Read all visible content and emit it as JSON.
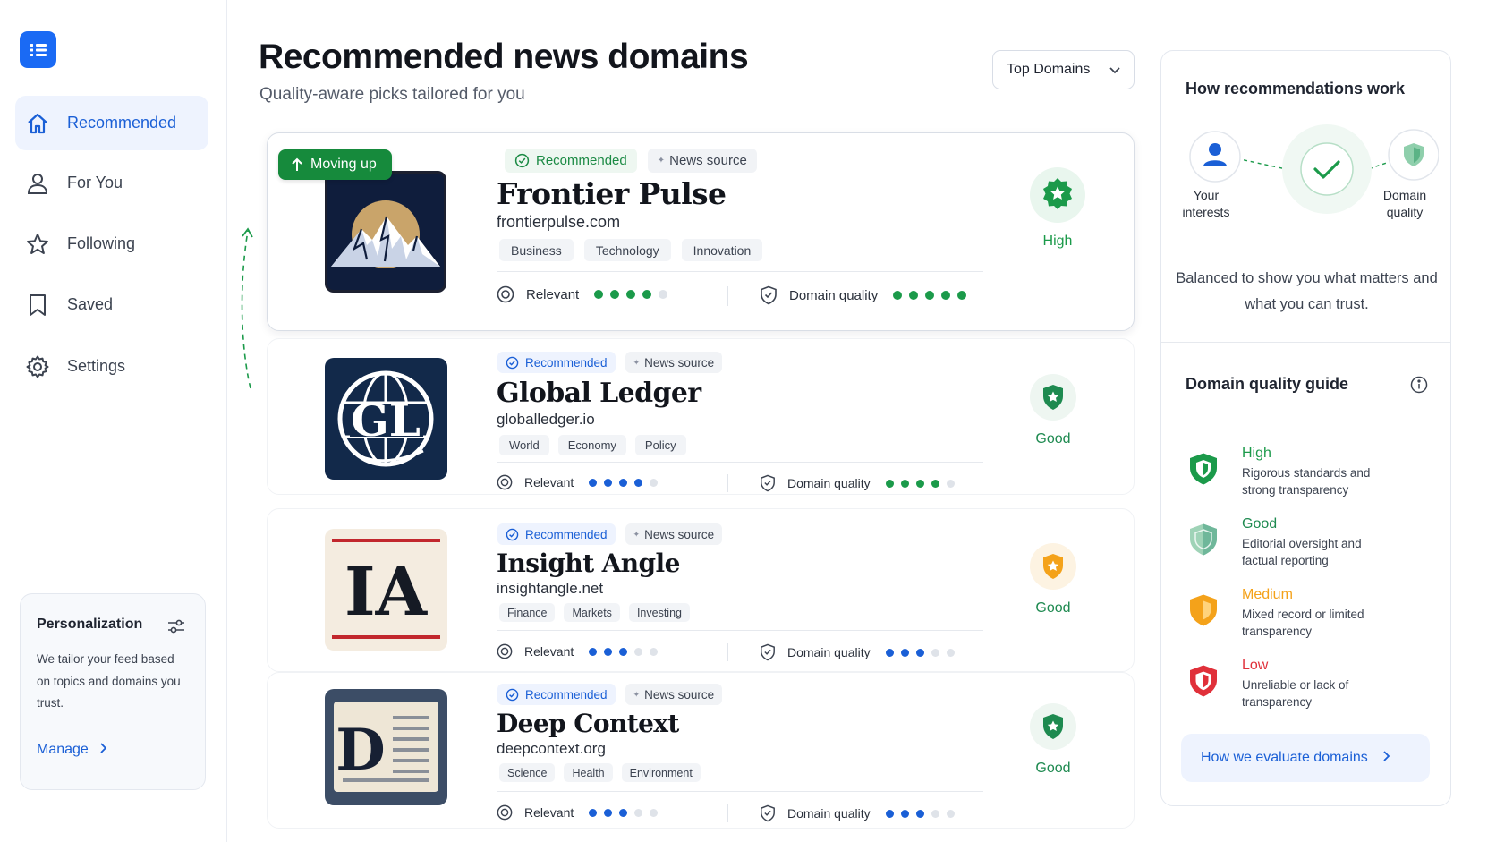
{
  "sidebar": {
    "logo_icon": "list-app-icon",
    "items": [
      {
        "label": "Recommended",
        "icon": "home-icon",
        "active": true
      },
      {
        "label": "For You",
        "icon": "user-icon",
        "active": false
      },
      {
        "label": "Following",
        "icon": "star-icon",
        "active": false
      },
      {
        "label": "Saved",
        "icon": "bookmark-icon",
        "active": false
      },
      {
        "label": "Settings",
        "icon": "gear-icon",
        "active": false
      }
    ],
    "personalization": {
      "title": "Personalization",
      "description": "We tailor your feed based on topics and domains you trust.",
      "link": "Manage"
    }
  },
  "header": {
    "title": "Recommended news domains",
    "subtitle": "Quality-aware picks tailored for you",
    "filter": "Top Domains"
  },
  "cards": [
    {
      "rank_badge": "Moving up",
      "recommended": "Recommended",
      "source_type": "News source",
      "name": "Frontier Pulse",
      "domain": "frontierpulse.com",
      "tags": [
        "Business",
        "Technology",
        "Innovation"
      ],
      "relevance_label": "Relevant",
      "relevance": 4,
      "quality_label": "Domain quality",
      "quality_level": 5,
      "rating": "High"
    },
    {
      "recommended": "Recommended",
      "source_type": "News source",
      "name": "Global Ledger",
      "domain": "globalledger.io",
      "logo_text": "GL",
      "tags": [
        "World",
        "Economy",
        "Policy"
      ],
      "relevance_label": "Relevant",
      "relevance": 4,
      "quality_label": "Domain quality",
      "quality_level": 4,
      "rating": "Good"
    },
    {
      "recommended": "Recommended",
      "source_type": "News source",
      "name": "Insight Angle",
      "domain": "insightangle.net",
      "logo_text": "IA",
      "tags": [
        "Finance",
        "Markets",
        "Investing"
      ],
      "relevance_label": "Relevant",
      "relevance": 3,
      "quality_label": "Domain quality",
      "quality_level": 3,
      "rating": "Good"
    },
    {
      "recommended": "Recommended",
      "source_type": "News source",
      "name": "Deep Context",
      "domain": "deepcontext.org",
      "logo_text": "D",
      "tags": [
        "Science",
        "Health",
        "Environment"
      ],
      "relevance_label": "Relevant",
      "relevance": 3,
      "quality_label": "Domain quality",
      "quality_level": 3,
      "rating": "Good"
    }
  ],
  "panel": {
    "title": "How recommendations work",
    "flow": {
      "left": "Your interests",
      "right": "Domain quality"
    },
    "description": "Balanced to show you what matters and what you can trust.",
    "guide_title": "Domain quality guide",
    "guide": [
      {
        "name": "High",
        "desc": "Rigorous standards and strong transparency",
        "color": "#1b9a4a"
      },
      {
        "name": "Good",
        "desc": "Editorial oversight and factual reporting",
        "color": "#6fb79a"
      },
      {
        "name": "Medium",
        "desc": "Mixed record or limited transparency",
        "color": "#f4a21a"
      },
      {
        "name": "Low",
        "desc": "Unreliable or lack of transparency",
        "color": "#e0303a"
      }
    ],
    "cta": "How we evaluate domains"
  },
  "colors": {
    "accent": "#1a6af4",
    "green": "#1b9a4a",
    "blue_dot": "#1a5fd6",
    "empty_dot": "#dfe3e9"
  }
}
